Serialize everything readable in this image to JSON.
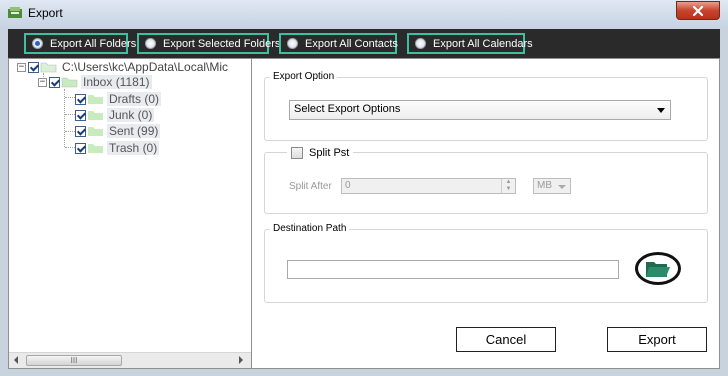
{
  "window": {
    "title": "Export"
  },
  "export_modes": [
    {
      "label": "Export All Folders",
      "selected": true
    },
    {
      "label": "Export Selected Folders",
      "selected": false
    },
    {
      "label": "Export All Contacts",
      "selected": false
    },
    {
      "label": "Export All Calendars",
      "selected": false
    }
  ],
  "tree": {
    "root": {
      "label": "C:\\Users\\kc\\AppData\\Local\\Mic",
      "expanded": true,
      "checked": true
    },
    "inbox": {
      "label": "Inbox (1181)",
      "expanded": true,
      "checked": true
    },
    "children": [
      {
        "label": "Drafts (0)",
        "checked": true
      },
      {
        "label": "Junk (0)",
        "checked": true
      },
      {
        "label": "Sent (99)",
        "checked": true
      },
      {
        "label": "Trash (0)",
        "checked": true
      }
    ],
    "expander_minus": "−",
    "scroll_grip": "III"
  },
  "export_option": {
    "title": "Export Option",
    "selected_value": "Select Export Options"
  },
  "split": {
    "checkbox_label": "Split Pst",
    "checked": false,
    "split_after_label": "Split After",
    "value": "0",
    "unit": "MB"
  },
  "destination": {
    "title": "Destination Path",
    "value": ""
  },
  "buttons": {
    "cancel": "Cancel",
    "export": "Export"
  },
  "colors": {
    "accent_border": "#3ec0a0",
    "strip_bg": "#2a2a2a",
    "close_red": "#c7442d"
  }
}
